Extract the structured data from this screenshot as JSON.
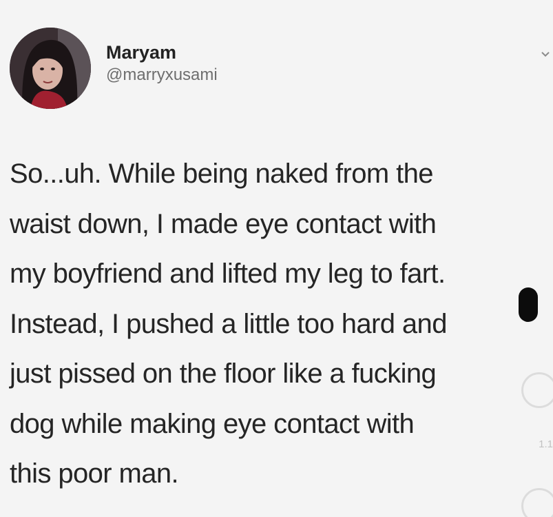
{
  "tweet": {
    "author": {
      "display_name": "Maryam",
      "handle": "@marryxusami",
      "avatar_icon": "profile-photo"
    },
    "menu_icon": "chevron-down-icon",
    "lines": [
      "So...uh. While being naked from the",
      "waist down, I made eye contact with",
      "my boyfriend and lifted my leg to fart.",
      "Instead, I pushed a little too hard and",
      "just pissed on the floor like a fucking",
      "dog while making eye contact with",
      "this poor man."
    ],
    "faint_count": "1.1"
  },
  "colors": {
    "background": "#f4f4f4",
    "text": "#252525",
    "handle": "#6e6e6e"
  }
}
